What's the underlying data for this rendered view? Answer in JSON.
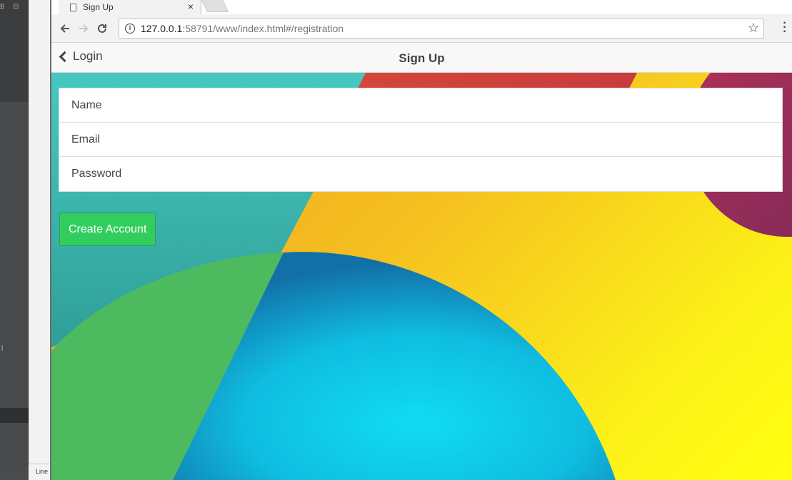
{
  "browser": {
    "tab_title": "Sign Up",
    "tab_close": "×",
    "url_host": "127.0.0.1",
    "url_rest": ":58791/www/index.html#/registration"
  },
  "editor": {
    "status_text": "Line"
  },
  "app": {
    "back_label": "Login",
    "title": "Sign Up"
  },
  "form": {
    "fields": [
      {
        "placeholder": "Name"
      },
      {
        "placeholder": "Email"
      },
      {
        "placeholder": "Password"
      }
    ],
    "submit_label": "Create Account"
  },
  "colors": {
    "button_green": "#33cd5f"
  }
}
